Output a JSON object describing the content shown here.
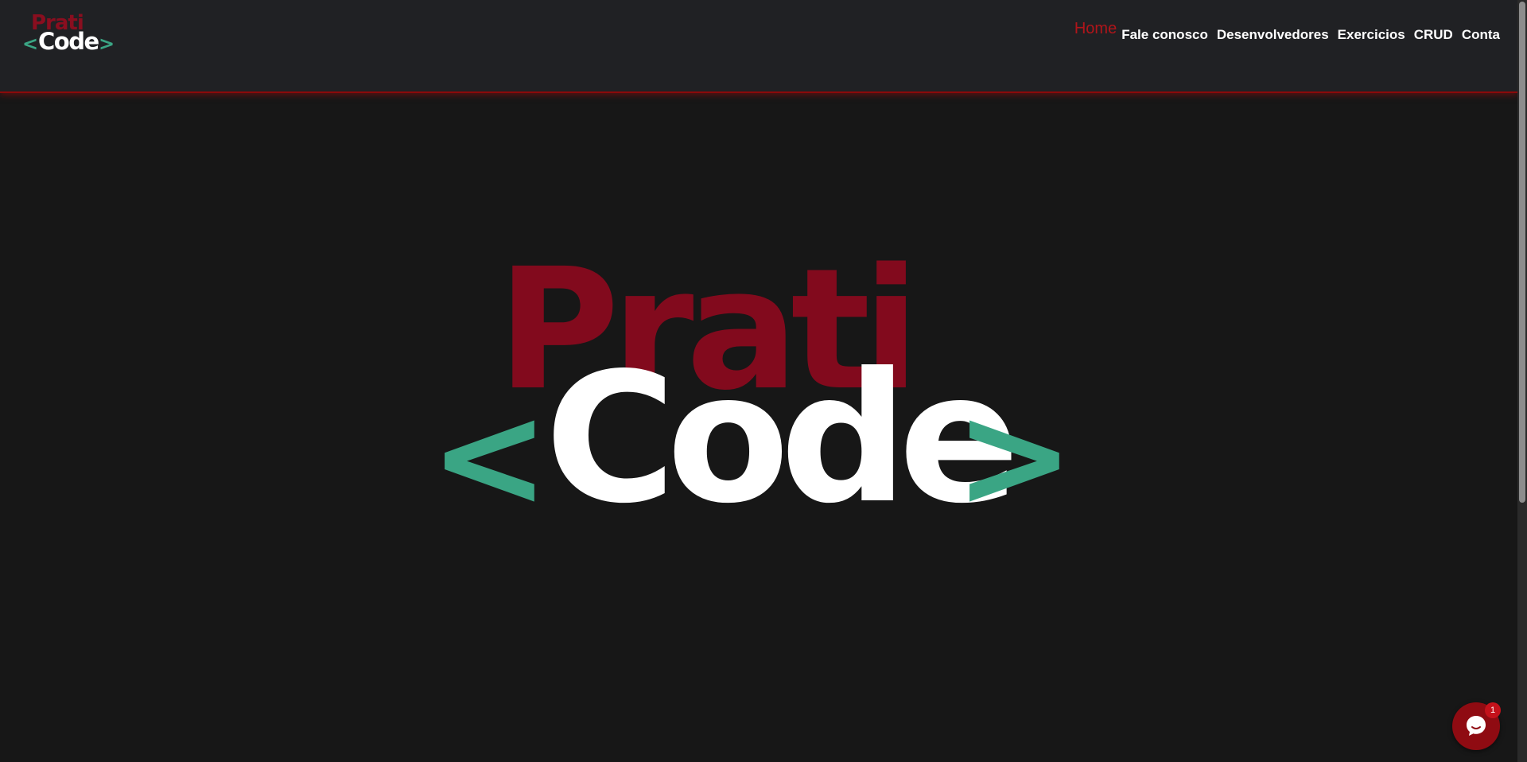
{
  "brand": {
    "name_top": "Prati",
    "name_bottom": "Code",
    "bracket_open": "<",
    "bracket_close": ">",
    "colors": {
      "prati": "#820a1d",
      "code": "#ffffff",
      "brackets": "#3aa584"
    }
  },
  "nav": {
    "items": [
      {
        "label": "Home",
        "active": true
      },
      {
        "label": "Fale conosco",
        "active": false
      },
      {
        "label": "Desenvolvedores",
        "active": false
      },
      {
        "label": "Exercicios",
        "active": false
      },
      {
        "label": "CRUD",
        "active": false
      },
      {
        "label": "Conta",
        "active": false
      }
    ],
    "active_color": "#b0151a"
  },
  "chat": {
    "icon": "chat-bubble-icon",
    "badge_count": "1",
    "color": "#8f0b12"
  },
  "theme": {
    "header_bg": "#202124",
    "page_bg": "#171717",
    "accent_border": "#8b0a0a"
  }
}
